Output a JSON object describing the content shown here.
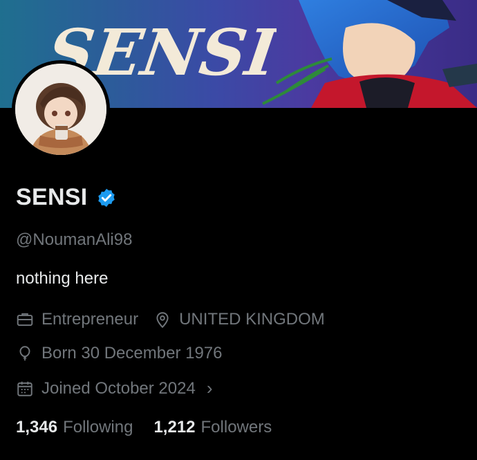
{
  "banner": {
    "title": "SENSI"
  },
  "profile": {
    "display_name": "SENSI",
    "handle": "@NoumanAli98",
    "bio": "nothing here",
    "profession": "Entrepreneur",
    "location": "UNITED KINGDOM",
    "born": "Born 30 December 1976",
    "joined": "Joined October 2024",
    "following_count": "1,346",
    "following_label": "Following",
    "followers_count": "1,212",
    "followers_label": "Followers"
  },
  "icons": {
    "verified": "verified-badge-icon",
    "profession": "briefcase-icon",
    "location": "location-pin-icon",
    "born": "balloon-icon",
    "joined": "calendar-icon",
    "expand": "chevron-right-icon"
  },
  "colors": {
    "background": "#000000",
    "text": "#e7e9ea",
    "muted": "#71767b",
    "verified": "#1d9bf0"
  }
}
